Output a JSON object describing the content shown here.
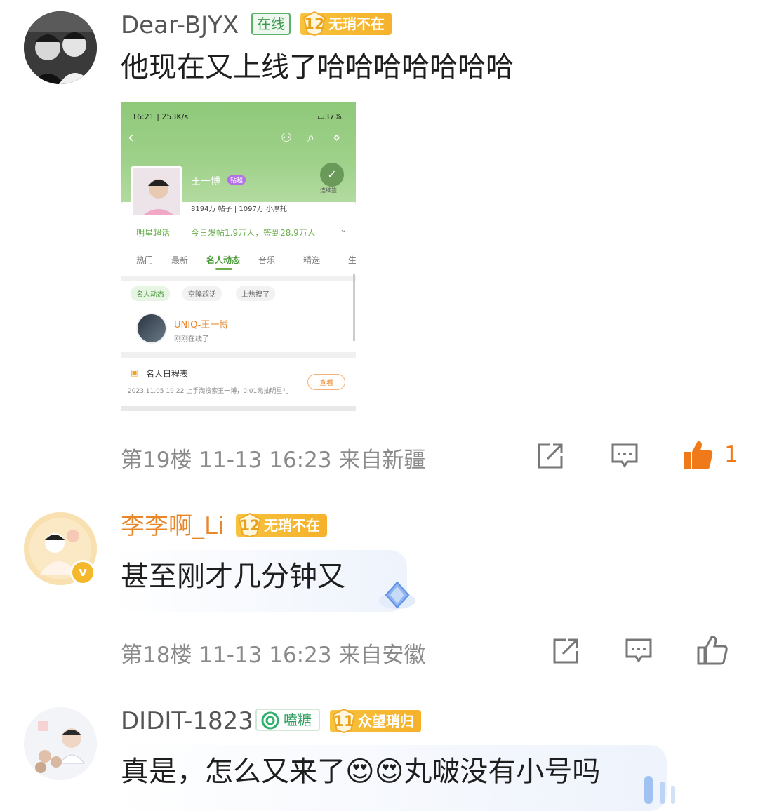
{
  "comments": [
    {
      "username": "Dear-BJYX",
      "online_badge": "在线",
      "level": "12",
      "level_title": "无琑不在",
      "text": "他现在又上线了哈哈哈哈哈哈哈",
      "floor_meta": "第19楼 11-13 16:23 来自新疆",
      "like_count": "1",
      "liked": true
    },
    {
      "username": "李李啊_Li",
      "level": "12",
      "level_title": "无琑不在",
      "text": "甚至刚才几分钟又",
      "floor_meta": "第18楼 11-13 16:23 来自安徽",
      "like_count": "",
      "liked": false
    },
    {
      "username": "DIDIT-1823",
      "candy_badge": "嗑糖",
      "level": "11",
      "level_title": "众望琑归",
      "text": "真是，怎么又来了😍😍丸啵没有小号吗"
    }
  ],
  "screenshot": {
    "status_time": "16:21 | 253K/s",
    "battery": "37",
    "profile_name": "王一博",
    "profile_tag": "钻超",
    "checkin_label": "连续签...",
    "stats": "8194万 帖子 | 1097万 小摩托",
    "super_topic": "明星超话",
    "daily_stats": "今日发帖1.9万人，签到28.9万人",
    "tabs": [
      "热门",
      "最新",
      "名人动态",
      "音乐",
      "精选",
      "生"
    ],
    "chips": [
      "名人动态",
      "空降超话",
      "上热搜了"
    ],
    "celeb_name": "UNIQ-王一博",
    "celeb_status": "刚刚在线了",
    "schedule_title": "名人日程表",
    "schedule_item": "2023.11.05 19:22 上手淘搜索王一博，0.01元抽明星礼",
    "schedule_btn": "查看"
  },
  "colors": {
    "liked": "#f07a1a",
    "level_badge": "#f7c23d",
    "username_orange": "#e8862a",
    "online_green": "#3a9a4c",
    "meta_gray": "#8a8a8a"
  }
}
